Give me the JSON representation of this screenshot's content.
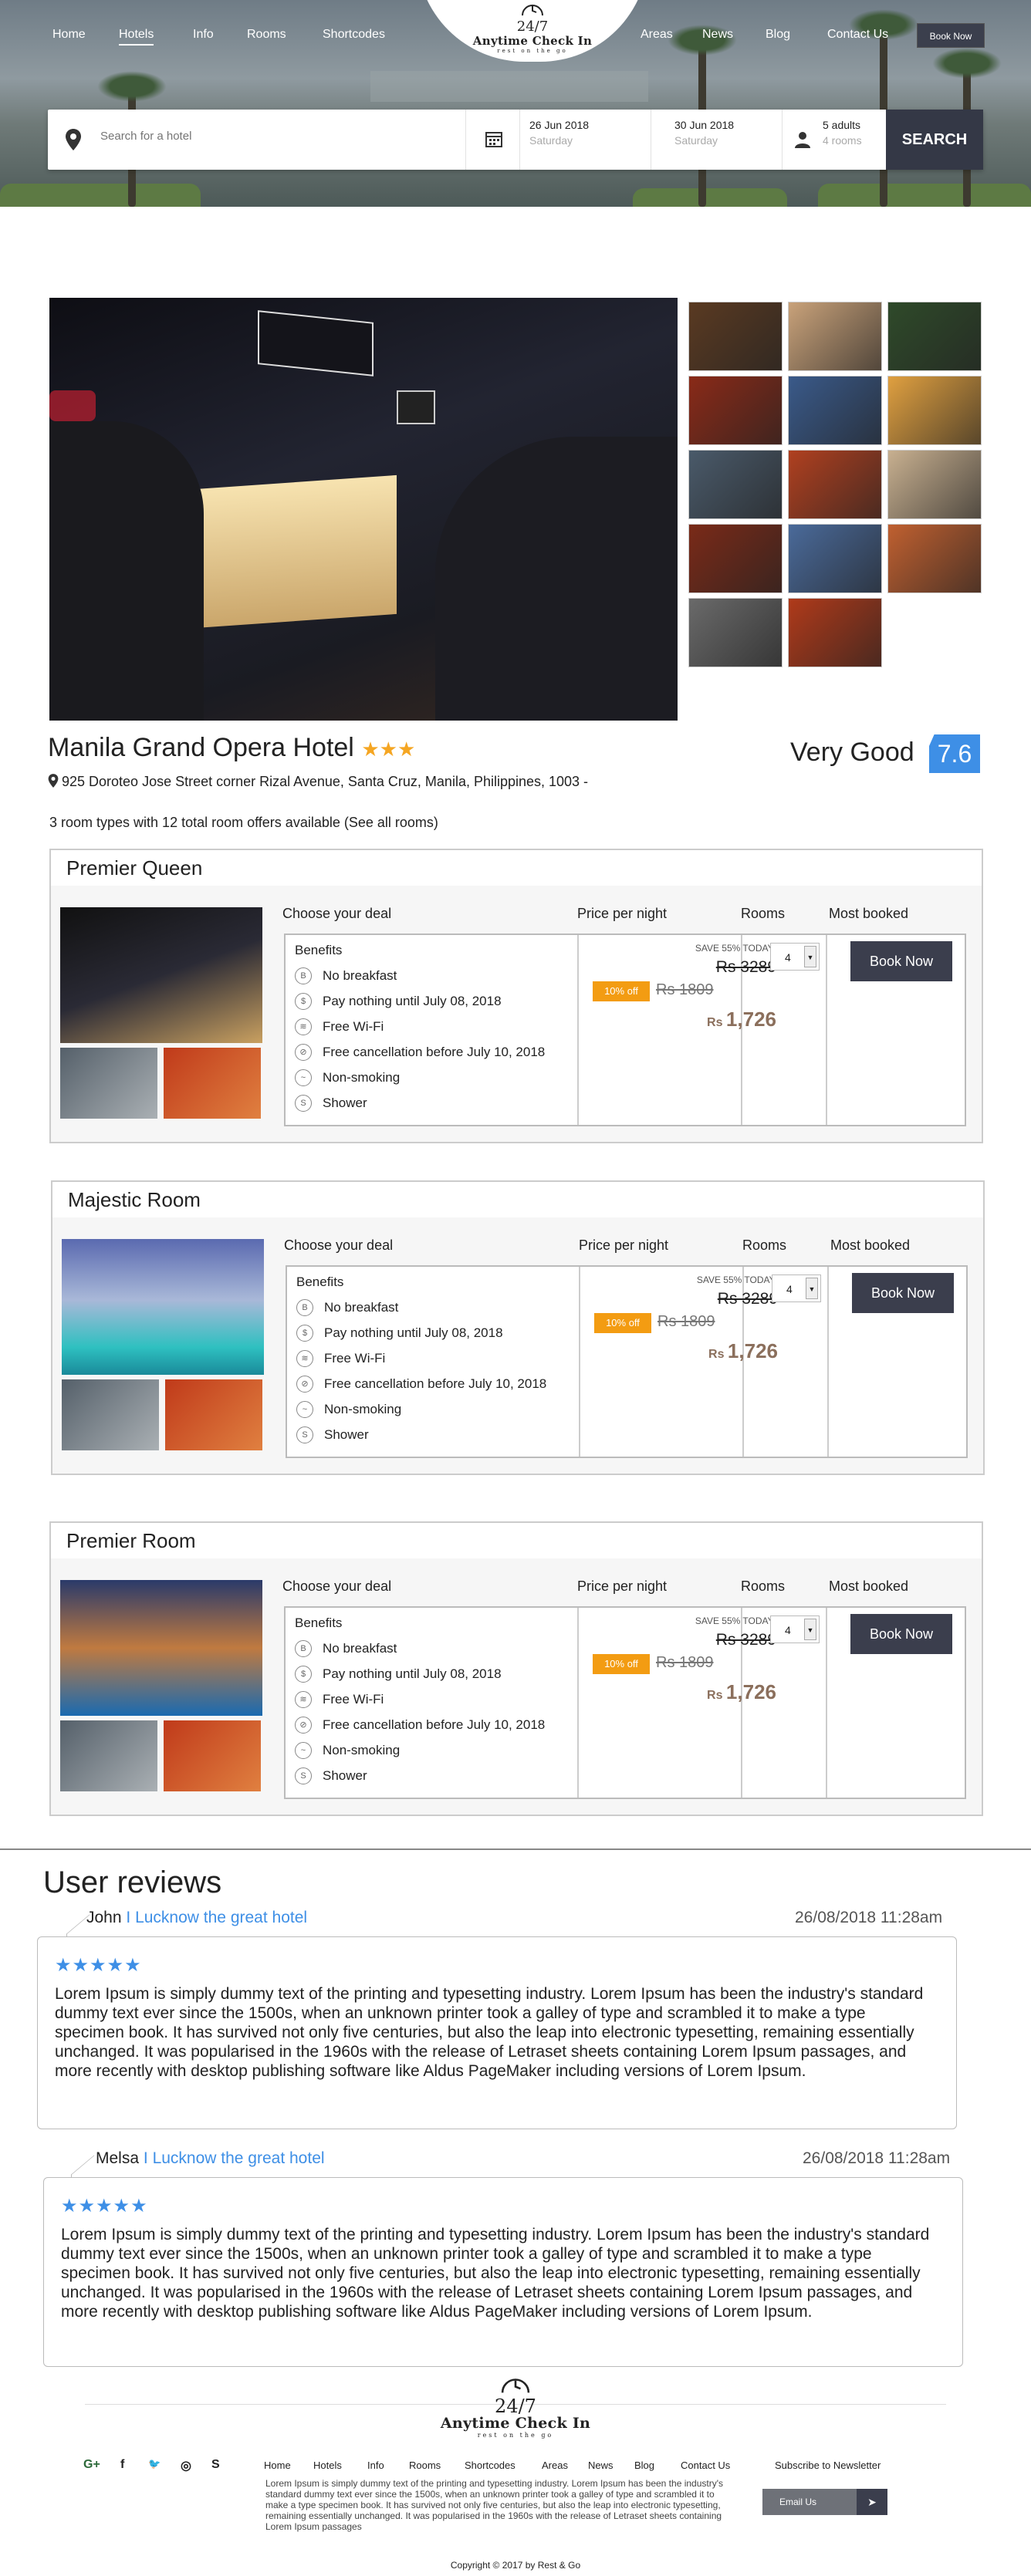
{
  "nav": {
    "left": [
      "Home",
      "Hotels",
      "Info",
      "Rooms",
      "Shortcodes"
    ],
    "right": [
      "Areas",
      "News",
      "Blog",
      "Contact Us"
    ],
    "book_now": "Book Now"
  },
  "logo": {
    "number": "24/7",
    "name": "Anytime Check In",
    "tagline": "rest on the go"
  },
  "search": {
    "placeholder": "Search for a hotel",
    "checkin_date": "26 Jun 2018",
    "checkin_day": "Saturday",
    "checkout_date": "30 Jun 2018",
    "checkout_day": "Saturday",
    "guests": "5 adults",
    "rooms": "4 rooms",
    "button": "SEARCH"
  },
  "hotel": {
    "name": "Manila Grand Opera Hotel",
    "stars": "★★★",
    "address": "925 Doroteo Jose Street corner Rizal Avenue, Santa Cruz, Manila, Philippines, 1003 -",
    "rating_text": "Very Good",
    "rating_score": "7.6",
    "room_summary": "3 room types with 12 total room offers available (See all rooms)"
  },
  "room_headers": {
    "deal": "Choose your deal",
    "price": "Price per night",
    "rooms": "Rooms",
    "most": "Most booked"
  },
  "rooms": [
    {
      "title": "Premier Queen",
      "benefits_title": "Benefits",
      "benefits": [
        "No breakfast",
        "Pay nothing until July 08, 2018",
        "Free Wi-Fi",
        "Free cancellation before July 10, 2018",
        "Non-smoking",
        "Shower"
      ],
      "save": "SAVE 55% TODAY!",
      "old_price": "Rs 3289",
      "badge": "10% off",
      "old_price2": "Rs 1809",
      "currency": "Rs",
      "price": "1,726",
      "qty": "4",
      "book": "Book Now"
    },
    {
      "title": "Majestic Room",
      "benefits_title": "Benefits",
      "benefits": [
        "No breakfast",
        "Pay nothing until July 08, 2018",
        "Free Wi-Fi",
        "Free cancellation before July 10, 2018",
        "Non-smoking",
        "Shower"
      ],
      "save": "SAVE 55% TODAY!",
      "old_price": "Rs 3289",
      "badge": "10% off",
      "old_price2": "Rs 1809",
      "currency": "Rs",
      "price": "1,726",
      "qty": "4",
      "book": "Book Now"
    },
    {
      "title": "Premier Room",
      "benefits_title": "Benefits",
      "benefits": [
        "No breakfast",
        "Pay nothing until July 08, 2018",
        "Free Wi-Fi",
        "Free cancellation before July 10, 2018",
        "Non-smoking",
        "Shower"
      ],
      "save": "SAVE 55% TODAY!",
      "old_price": "Rs 3289",
      "badge": "10% off",
      "old_price2": "Rs 1809",
      "currency": "Rs",
      "price": "1,726",
      "qty": "4",
      "book": "Book Now"
    }
  ],
  "reviews": {
    "title": "User reviews",
    "items": [
      {
        "author": "John",
        "sep": "I",
        "headline": "Lucknow the great hotel",
        "date": "26/08/2018  11:28am",
        "stars": "★★★★★",
        "text": "Lorem Ipsum is simply dummy text of the printing and typesetting industry. Lorem Ipsum has been the industry's standard dummy text ever since the 1500s, when an unknown printer took a galley of type and scrambled it to make a type specimen book. It has survived not only five centuries, but also the leap into electronic typesetting, remaining essentially unchanged. It was popularised in the 1960s with the release of Letraset sheets containing Lorem Ipsum passages, and more recently with desktop publishing software like Aldus PageMaker including versions of Lorem Ipsum."
      },
      {
        "author": "Melsa",
        "sep": "I",
        "headline": "Lucknow the great hotel",
        "date": "26/08/2018  11:28am",
        "stars": "★★★★★",
        "text": "Lorem Ipsum is simply dummy text of the printing and typesetting industry. Lorem Ipsum has been the industry's standard dummy text ever since the 1500s, when an unknown printer took a galley of type and scrambled it to make a type specimen book. It has survived not only five centuries, but also the leap into electronic typesetting, remaining essentially unchanged. It was popularised in the 1960s with the release of Letraset sheets containing Lorem Ipsum passages, and more recently with desktop publishing software like Aldus PageMaker including versions of Lorem Ipsum."
      }
    ]
  },
  "footer": {
    "social": [
      "G+",
      "f",
      "🐦",
      "◎",
      "S"
    ],
    "nav": [
      "Home",
      "Hotels",
      "Info",
      "Rooms",
      "Shortcodes",
      "Areas",
      "News",
      "Blog",
      "Contact Us"
    ],
    "text": "Lorem Ipsum is simply dummy text of the printing and typesetting industry. Lorem Ipsum has been the industry's standard dummy text ever since the 1500s, when an unknown printer took a galley of type and scrambled it to make a type specimen book. It has survived not only five centuries, but also the leap into electronic typesetting, remaining essentially unchanged. It was popularised in the 1960s with the release of Letraset sheets containing Lorem Ipsum passages",
    "newsletter_title": "Subscribe to Newsletter",
    "newsletter_placeholder": "Email Us",
    "copyright": "Copyright © 2017 by Rest & Go"
  },
  "colors": {
    "accent": "#3e8fe6",
    "dark_button": "#3b3e4d",
    "badge": "#f39c12",
    "star": "#f5a623"
  }
}
